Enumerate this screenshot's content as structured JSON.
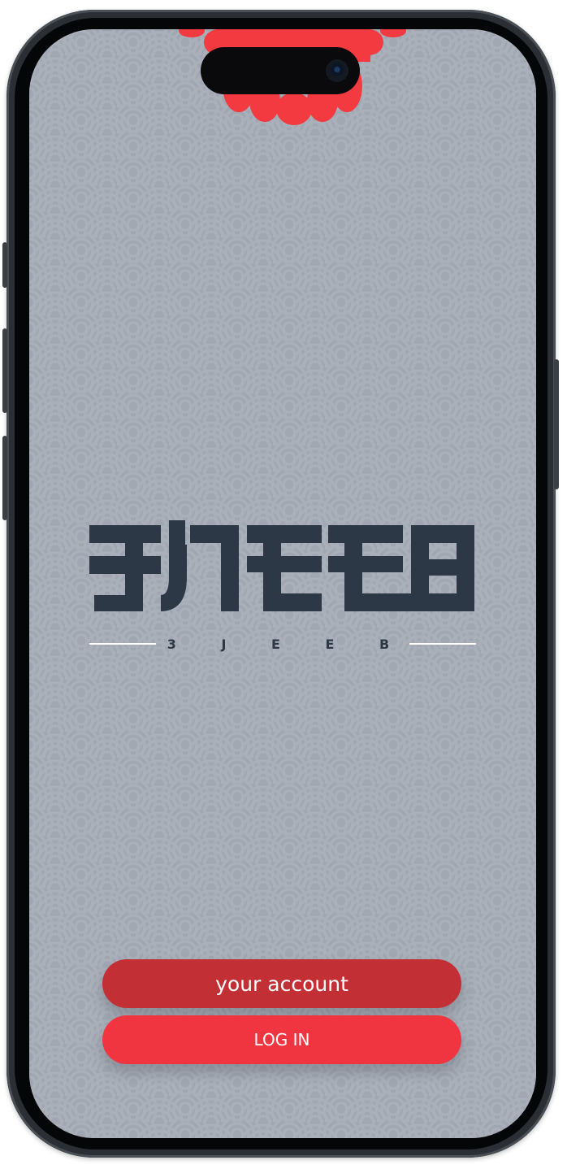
{
  "app": {
    "logo_glyphs": "3JEEB",
    "logo_caption": "3 J E E B"
  },
  "buttons": {
    "account_label": "your account",
    "login_label": "LOG IN"
  },
  "colors": {
    "background": "#a0a7b2",
    "wave_pattern": "#b1b7c1",
    "logo_dark": "#2c3845",
    "accent_red": "#f03440",
    "dark_red": "#c23035",
    "flower_red": "#f23a40"
  },
  "icons": {
    "decoration": "red-flower-icon",
    "camera": "front-camera-icon"
  }
}
